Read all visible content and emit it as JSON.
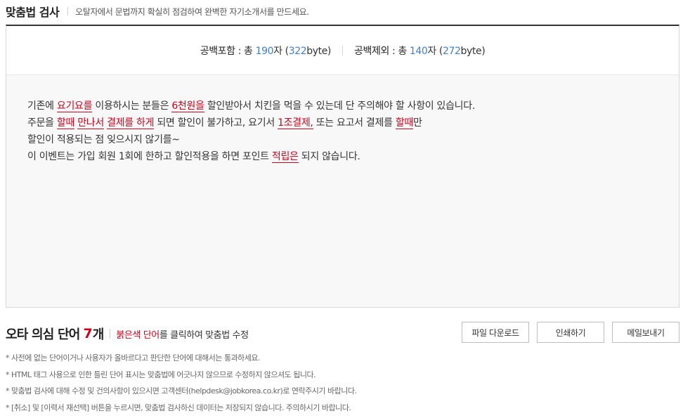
{
  "header": {
    "title": "맞춤법 검사",
    "description": "오탈자에서 문법까지 확실히 점검하여 완벽한 자기소개서를 만드세요."
  },
  "stats": {
    "with_space": {
      "label": "공백포함",
      "total_prefix": " : 총 ",
      "count": "190",
      "unit": "자 (",
      "bytes": "322",
      "bytes_unit": "byte)"
    },
    "without_space": {
      "label": "공백제외",
      "total_prefix": " : 총 ",
      "count": "140",
      "unit": "자 (",
      "bytes": "272",
      "bytes_unit": "byte)"
    }
  },
  "text": {
    "l1a": "기존에 ",
    "l1e1": "요기요를",
    "l1b": " 이용하시는 분들은 ",
    "l1e2": "6천원을",
    "l1c": " 할인받아서 치킨을 먹을 수 있는데 단 주의해야 할 사항이 있습니다.",
    "l2a": "주문을 ",
    "l2e1": "할때",
    "l2b": " ",
    "l2e2": "만나서",
    "l2c": " ",
    "l2e3": "결제를 하게",
    "l2d": " 되면 할인이 불가하고, 요기서 ",
    "l2e4": "1조결제,",
    "l2f": " 또는 요고서 결제를 ",
    "l2e5": "할때",
    "l2g": "만",
    "l3": "할인이 적용되는 점 잊으시지 않기를~",
    "l4a": "이 이벤트는 가입 회원 1회에 한하고 할인적용을 하면 포인트 ",
    "l4e1": "적립은",
    "l4b": " 되지 않습니다."
  },
  "summary": {
    "title": "오타 의심 단어",
    "count": "7",
    "count_unit": "개",
    "hint_red": "붉은색 단어",
    "hint_rest": "를 클릭하여 맞춤법 수정"
  },
  "buttons": {
    "download": "파일 다운로드",
    "print": "인쇄하기",
    "mail": "메일보내기"
  },
  "notes": [
    "* 사전에 없는 단어이거나 사용자가 올바르다고 판단한 단어에 대해서는 통과하세요.",
    "* HTML 태그 사용으로 인한 틀린 단어 표시는 맞춤법에 어긋나지 않으므로 수정하지 않으셔도 됩니다.",
    "* 맞춤법 검사에 대해 수정 및 건의사항이 있으시면 고객센터(helpdesk@jobkorea.co.kr)로 연락주시기 바랍니다.",
    "* [취소] 및 [이력서 재선택] 버튼을 누르시면, 맞춤법 검사하신 데이터는 저장되지 않습니다. 주의하시기 바랍니다."
  ],
  "colors": {
    "accent_blue": "#3d7fd9",
    "error_red": "#d0021b"
  }
}
